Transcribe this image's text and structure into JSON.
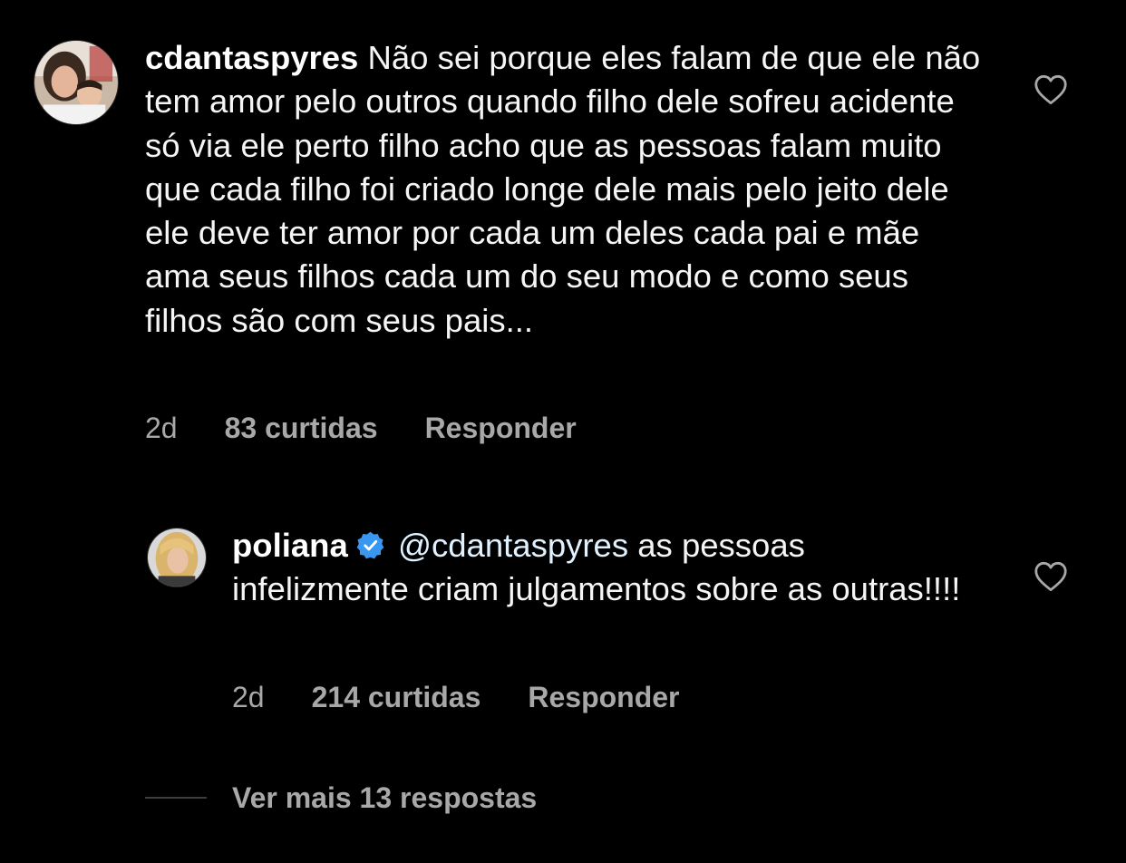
{
  "comments": [
    {
      "username": "cdantaspyres",
      "text": "Não sei porque eles falam de que ele não tem amor pelo outros quando filho dele sofreu acidente só via ele perto filho acho que as pessoas falam muito que cada filho foi criado longe dele mais pelo jeito dele ele deve ter amor por cada um deles  cada pai e mãe ama seus filhos cada um do seu modo e como seus filhos são com seus pais...",
      "time": "2d",
      "likes": "83 curtidas",
      "reply_label": "Responder",
      "like_icon": "heart-outline-icon"
    },
    {
      "username": "poliana",
      "verified": true,
      "mention": "@cdantaspyres",
      "text": "as pessoas infelizmente criam julgamentos sobre as outras!!!!",
      "time": "2d",
      "likes": "214 curtidas",
      "reply_label": "Responder",
      "like_icon": "heart-outline-icon"
    }
  ],
  "view_more_replies": "Ver mais 13 respostas",
  "colors": {
    "background": "#000000",
    "text": "#f5f5f5",
    "secondary": "#a8a8a8",
    "verified_badge": "#3897f0"
  }
}
